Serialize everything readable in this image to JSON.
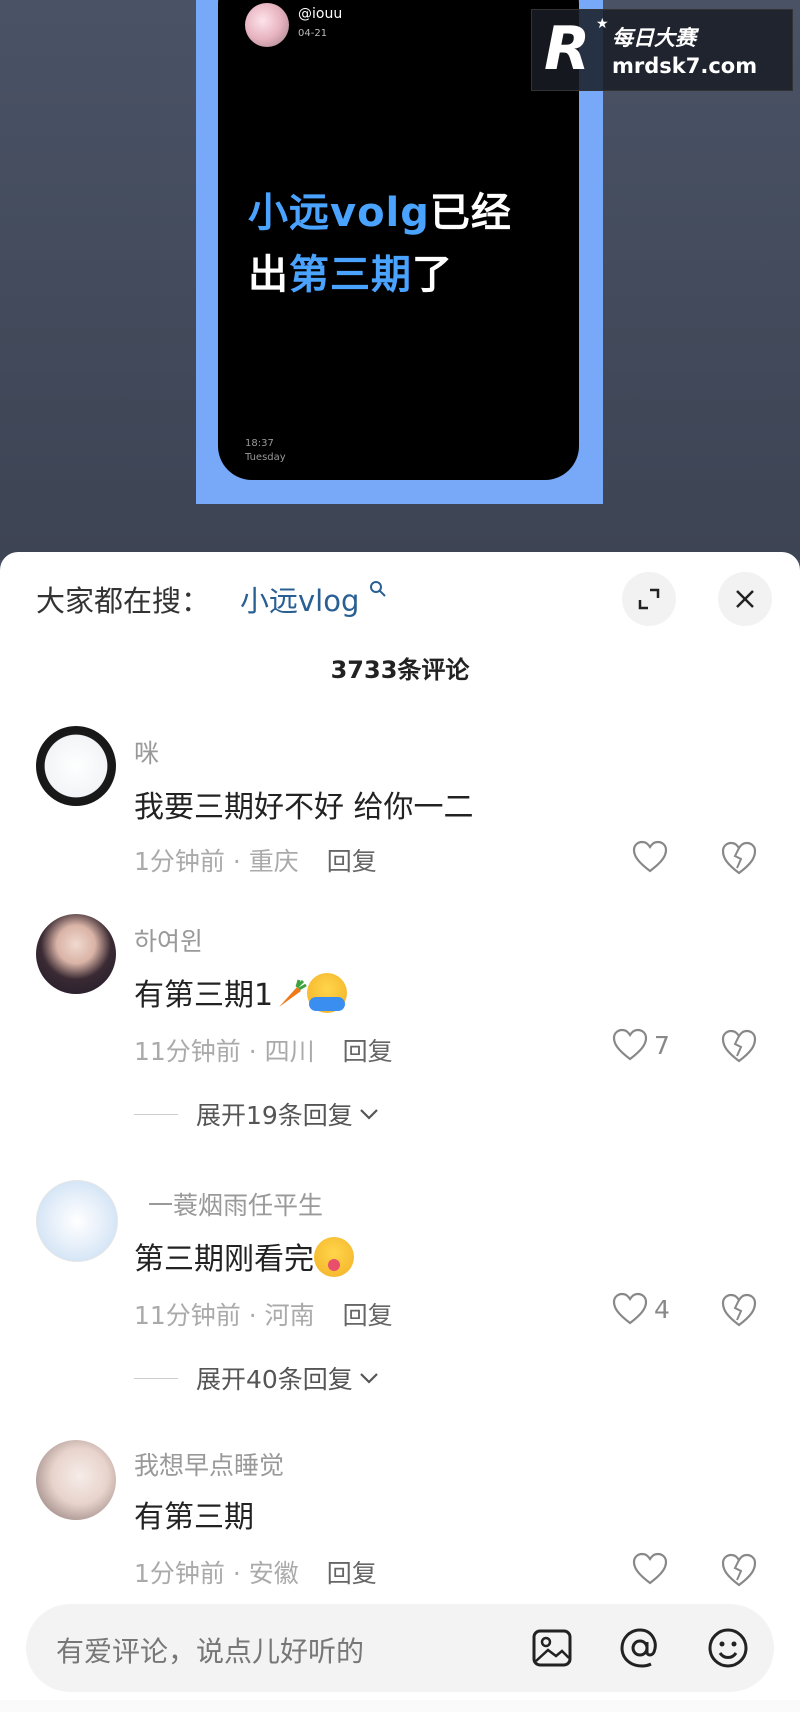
{
  "video": {
    "handle": "@iouu",
    "date": "04-21",
    "headline_line1_highlight": "小远volg",
    "headline_line1_rest": "已经",
    "headline_line2_pre": "出",
    "headline_line2_highlight": "第三期",
    "headline_line2_post": "了",
    "time": "18:37",
    "day": "Tuesday"
  },
  "watermark": {
    "logo_letter": "R",
    "name": "每日大赛",
    "url": "mrdsk7.com"
  },
  "sheet": {
    "hot_search_label": "大家都在搜：",
    "hot_search_term": "小远vlog",
    "count_title": "3733条评论"
  },
  "comments": [
    {
      "name": "咪",
      "text": "我要三期好不好 给你一二",
      "time": "1分钟前",
      "location": "重庆",
      "reply_label": "回复",
      "likes": ""
    },
    {
      "name": "하여윈",
      "text": "有第三期1",
      "time": "11分钟前",
      "location": "四川",
      "reply_label": "回复",
      "likes": "7",
      "expand_label": "展开19条回复"
    },
    {
      "name": "一蓑烟雨任平生",
      "text": "第三期刚看完",
      "time": "11分钟前",
      "location": "河南",
      "reply_label": "回复",
      "likes": "4",
      "expand_label": "展开40条回复"
    },
    {
      "name": "我想早点睡觉",
      "text": "有第三期",
      "time": "1分钟前",
      "location": "安徽",
      "reply_label": "回复",
      "likes": ""
    }
  ],
  "input": {
    "placeholder": "有爱评论，说点儿好听的"
  },
  "meta_separator": " · ",
  "icons": {
    "expand": "expand-icon",
    "close": "close-icon",
    "heart": "heart-icon",
    "dislike": "broken-heart-icon",
    "image": "image-icon",
    "at": "at-icon",
    "emoji": "emoji-icon",
    "search": "search-icon"
  },
  "colors": {
    "link": "#2a5f93",
    "highlight": "#4aa3ff",
    "frame": "#78a9f8"
  }
}
